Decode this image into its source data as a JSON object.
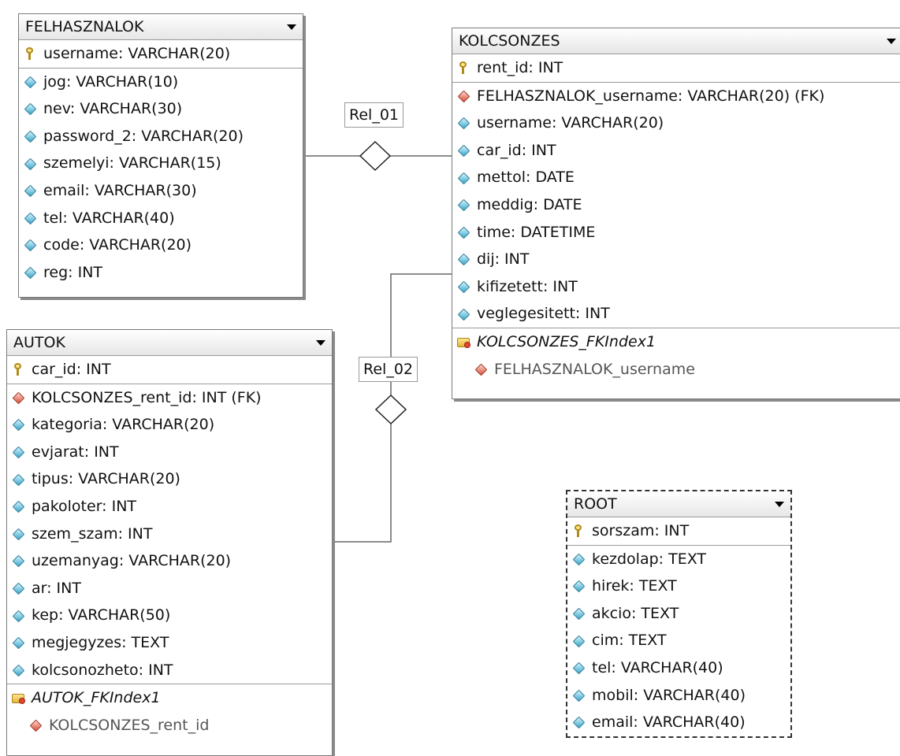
{
  "tables": {
    "felhasznalok": {
      "title": "FELHASZNALOK",
      "pk": "username: VARCHAR(20)",
      "cols": [
        "jog: VARCHAR(10)",
        "nev: VARCHAR(30)",
        "password_2: VARCHAR(20)",
        "szemelyi: VARCHAR(15)",
        "email: VARCHAR(30)",
        "tel: VARCHAR(40)",
        "code: VARCHAR(20)",
        "reg: INT"
      ]
    },
    "kolcsonzes": {
      "title": "KOLCSONZES",
      "pk": "rent_id: INT",
      "fk": "FELHASZNALOK_username: VARCHAR(20) (FK)",
      "cols": [
        "username: VARCHAR(20)",
        "car_id: INT",
        "mettol: DATE",
        "meddig: DATE",
        "time: DATETIME",
        "dij: INT",
        "kifizetett: INT",
        "veglegesitett: INT"
      ],
      "index_name": "KOLCSONZES_FKIndex1",
      "index_col": "FELHASZNALOK_username"
    },
    "autok": {
      "title": "AUTOK",
      "pk": "car_id: INT",
      "fk": "KOLCSONZES_rent_id: INT (FK)",
      "cols": [
        "kategoria: VARCHAR(20)",
        "evjarat: INT",
        "tipus: VARCHAR(20)",
        "pakoloter: INT",
        "szem_szam: INT",
        "uzemanyag: VARCHAR(20)",
        "ar: INT",
        "kep: VARCHAR(50)",
        "megjegyzes: TEXT",
        "kolcsonozheto: INT"
      ],
      "index_name": "AUTOK_FKIndex1",
      "index_col": "KOLCSONZES_rent_id"
    },
    "root": {
      "title": "ROOT",
      "pk": "sorszam: INT",
      "cols": [
        "kezdolap: TEXT",
        "hirek: TEXT",
        "akcio: TEXT",
        "cim: TEXT",
        "tel: VARCHAR(40)",
        "mobil: VARCHAR(40)",
        "email: VARCHAR(40)"
      ]
    }
  },
  "relations": {
    "rel1": "Rel_01",
    "rel2": "Rel_02"
  }
}
